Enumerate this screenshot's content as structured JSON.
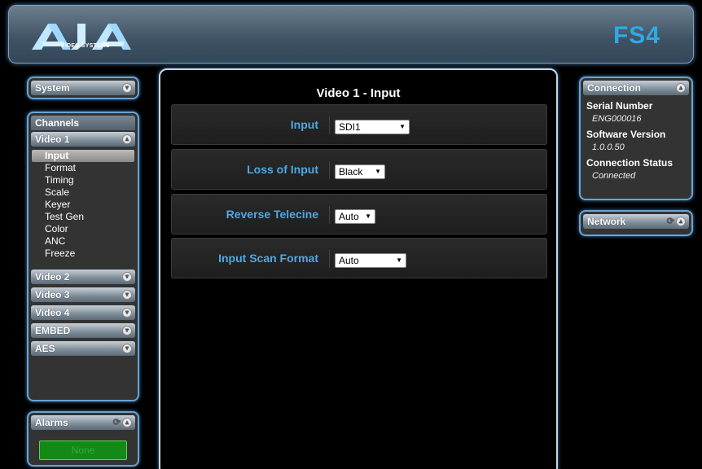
{
  "header": {
    "brand": "AJA",
    "brand_sub": "VIDEO SYSTEMS",
    "model": "FS4"
  },
  "left": {
    "system_label": "System",
    "channels_label": "Channels",
    "video1_label": "Video 1",
    "video1_items": [
      "Input",
      "Format",
      "Timing",
      "Scale",
      "Keyer",
      "Test Gen",
      "Color",
      "ANC",
      "Freeze"
    ],
    "active_item": "Input",
    "other_channels": [
      "Video 2",
      "Video 3",
      "Video 4",
      "EMBED",
      "AES"
    ],
    "alarms_label": "Alarms",
    "alarm_status": "None"
  },
  "main": {
    "title": "Video 1 - Input",
    "rows": [
      {
        "label": "Input",
        "value": "SDI1"
      },
      {
        "label": "Loss of Input",
        "value": "Black"
      },
      {
        "label": "Reverse Telecine",
        "value": "Auto"
      },
      {
        "label": "Input Scan Format",
        "value": "Auto"
      }
    ]
  },
  "right": {
    "connection_label": "Connection",
    "serial_label": "Serial Number",
    "serial_value": "ENG000016",
    "software_label": "Software Version",
    "software_value": "1.0.0.50",
    "status_label": "Connection Status",
    "status_value": "Connected",
    "network_label": "Network"
  },
  "colors": {
    "accent": "#4ea8e3",
    "panel_border": "#6aa3d3",
    "model_color": "#2fa9e6",
    "alarm_ok": "#138a18"
  }
}
